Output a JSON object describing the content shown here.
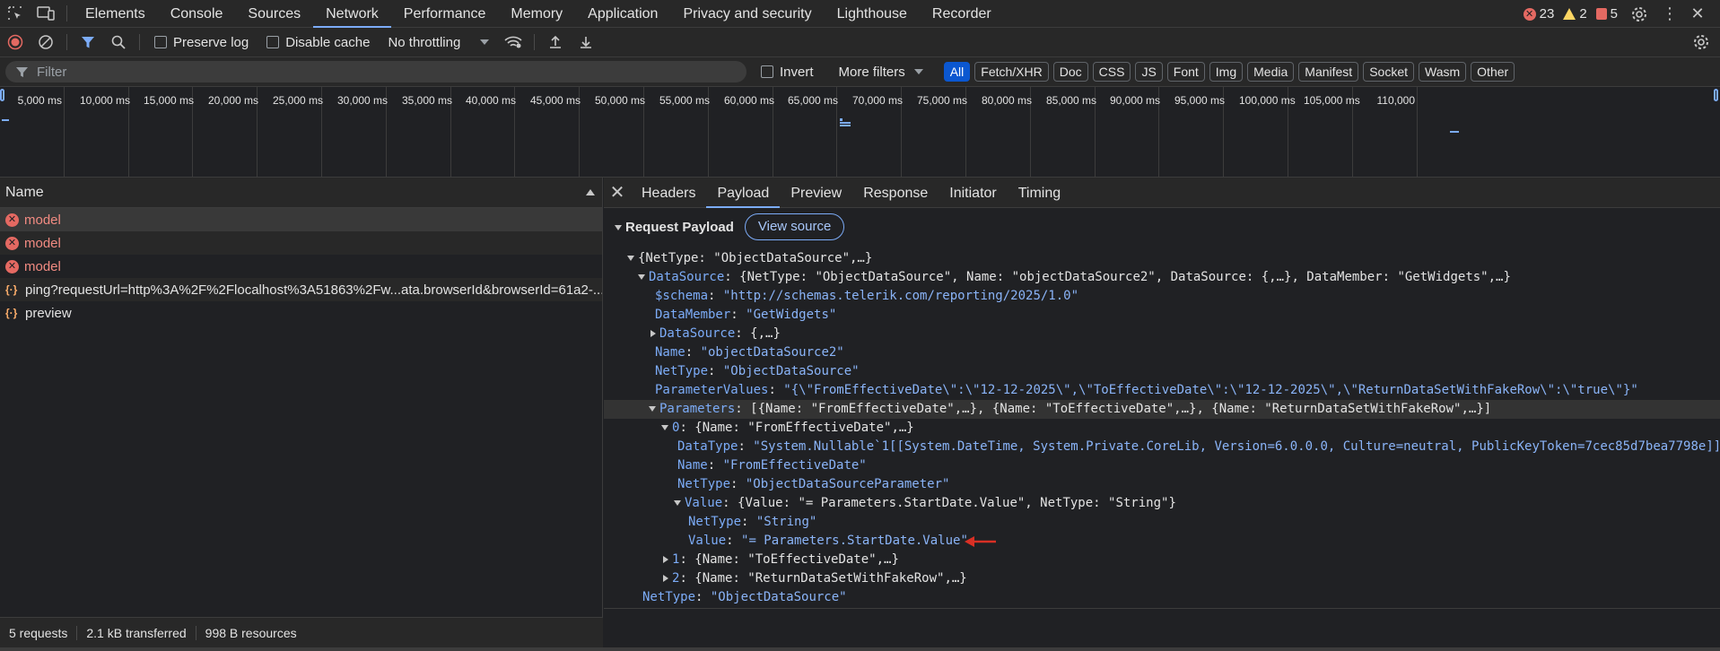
{
  "topbar": {
    "tabs": [
      "Elements",
      "Console",
      "Sources",
      "Network",
      "Performance",
      "Memory",
      "Application",
      "Privacy and security",
      "Lighthouse",
      "Recorder"
    ],
    "active_tab": "Network",
    "errors": "23",
    "warnings": "2",
    "issues": "5"
  },
  "toolbar": {
    "preserve_log": "Preserve log",
    "disable_cache": "Disable cache",
    "throttling": "No throttling"
  },
  "filter": {
    "placeholder": "Filter",
    "invert": "Invert",
    "more_filters": "More filters",
    "types": [
      "All",
      "Fetch/XHR",
      "Doc",
      "CSS",
      "JS",
      "Font",
      "Img",
      "Media",
      "Manifest",
      "Socket",
      "Wasm",
      "Other"
    ],
    "active_type": "All"
  },
  "timeline": {
    "ticks": [
      "5,000 ms",
      "10,000 ms",
      "15,000 ms",
      "20,000 ms",
      "25,000 ms",
      "30,000 ms",
      "35,000 ms",
      "40,000 ms",
      "45,000 ms",
      "50,000 ms",
      "55,000 ms",
      "60,000 ms",
      "65,000 ms",
      "70,000 ms",
      "75,000 ms",
      "80,000 ms",
      "85,000 ms",
      "90,000 ms",
      "95,000 ms",
      "100,000 ms",
      "105,000 ms",
      "110,000"
    ]
  },
  "requests": {
    "header": "Name",
    "items": [
      {
        "name": "model",
        "status": "error"
      },
      {
        "name": "model",
        "status": "error"
      },
      {
        "name": "model",
        "status": "error"
      },
      {
        "name": "ping?requestUrl=http%3A%2F%2Flocalhost%3A51863%2Fw...ata.browserId&browserId=61a2-...",
        "status": "json"
      },
      {
        "name": "preview",
        "status": "json"
      }
    ]
  },
  "status": {
    "requests": "5 requests",
    "transferred": "2.1 kB transferred",
    "resources": "998 B resources"
  },
  "detail": {
    "tabs": [
      "Headers",
      "Payload",
      "Preview",
      "Response",
      "Initiator",
      "Timing"
    ],
    "active_tab": "Payload",
    "section_title": "Request Payload",
    "view_source": "View source"
  },
  "payload": {
    "l1": "{NetType: \"ObjectDataSource\",…}",
    "l2_key": "DataSource",
    "l2_val": "{NetType: \"ObjectDataSource\", Name: \"objectDataSource2\", DataSource: {,…}, DataMember: \"GetWidgets\",…}",
    "l3_key": "$schema",
    "l3_val": "\"http://schemas.telerik.com/reporting/2025/1.0\"",
    "l4_key": "DataMember",
    "l4_val": "\"GetWidgets\"",
    "l5_key": "DataSource",
    "l5_val": "{,…}",
    "l6_key": "Name",
    "l6_val": "\"objectDataSource2\"",
    "l7_key": "NetType",
    "l7_val": "\"ObjectDataSource\"",
    "l8_key": "ParameterValues",
    "l8_val": "\"{\\\"FromEffectiveDate\\\":\\\"12-12-2025\\\",\\\"ToEffectiveDate\\\":\\\"12-12-2025\\\",\\\"ReturnDataSetWithFakeRow\\\":\\\"true\\\"}\"",
    "l9_key": "Parameters",
    "l9_val": "[{Name: \"FromEffectiveDate\",…}, {Name: \"ToEffectiveDate\",…}, {Name: \"ReturnDataSetWithFakeRow\",…}]",
    "l10_key": "0",
    "l10_val": "{Name: \"FromEffectiveDate\",…}",
    "l11_key": "DataType",
    "l11_val": "\"System.Nullable`1[[System.DateTime, System.Private.CoreLib, Version=6.0.0.0, Culture=neutral, PublicKeyToken=7cec85d7bea7798e]]\"",
    "l12_key": "Name",
    "l12_val": "\"FromEffectiveDate\"",
    "l13_key": "NetType",
    "l13_val": "\"ObjectDataSourceParameter\"",
    "l14_key": "Value",
    "l14_val": "{Value: \"= Parameters.StartDate.Value\", NetType: \"String\"}",
    "l15_key": "NetType",
    "l15_val": "\"String\"",
    "l16_key": "Value",
    "l16_val": "\"= Parameters.StartDate.Value\"",
    "l17_key": "1",
    "l17_val": "{Name: \"ToEffectiveDate\",…}",
    "l18_key": "2",
    "l18_val": "{Name: \"ReturnDataSetWithFakeRow\",…}",
    "l19_key": "NetType",
    "l19_val": "\"ObjectDataSource\""
  },
  "colors": {
    "accent": "#7cacf8",
    "error": "#e46962",
    "annotation_arrow": "#d93025"
  }
}
